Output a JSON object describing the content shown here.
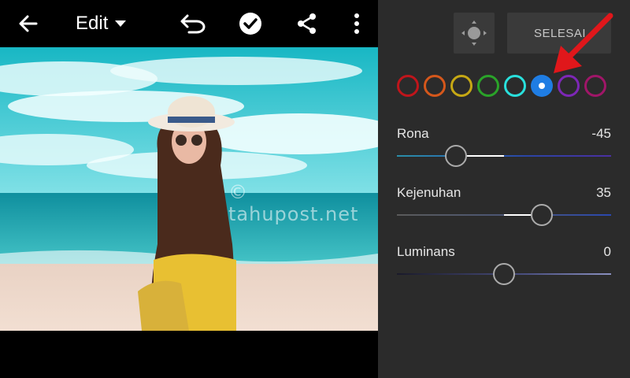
{
  "toolbar": {
    "edit_label": "Edit"
  },
  "watermark": "© tahupost.net",
  "panel": {
    "done_label": "SELESAI",
    "swatches": [
      {
        "name": "red",
        "color": "#c0151b"
      },
      {
        "name": "orange",
        "color": "#d5571b"
      },
      {
        "name": "yellow",
        "color": "#c6a814"
      },
      {
        "name": "green",
        "color": "#2aa329"
      },
      {
        "name": "aqua",
        "color": "#29e0dc"
      },
      {
        "name": "blue",
        "color": "#1f7de3",
        "selected": true
      },
      {
        "name": "purple",
        "color": "#7d27b6"
      },
      {
        "name": "magenta",
        "color": "#a01668"
      }
    ],
    "sliders": {
      "rona": {
        "label": "Rona",
        "value": "-45",
        "min": -100,
        "max": 100
      },
      "kejenuhan": {
        "label": "Kejenuhan",
        "value": "35",
        "min": -100,
        "max": 100
      },
      "luminans": {
        "label": "Luminans",
        "value": "0",
        "min": -100,
        "max": 100
      }
    }
  },
  "colors": {
    "accent_arrow": "#e0171b",
    "panel_bg": "#2b2b2b"
  }
}
